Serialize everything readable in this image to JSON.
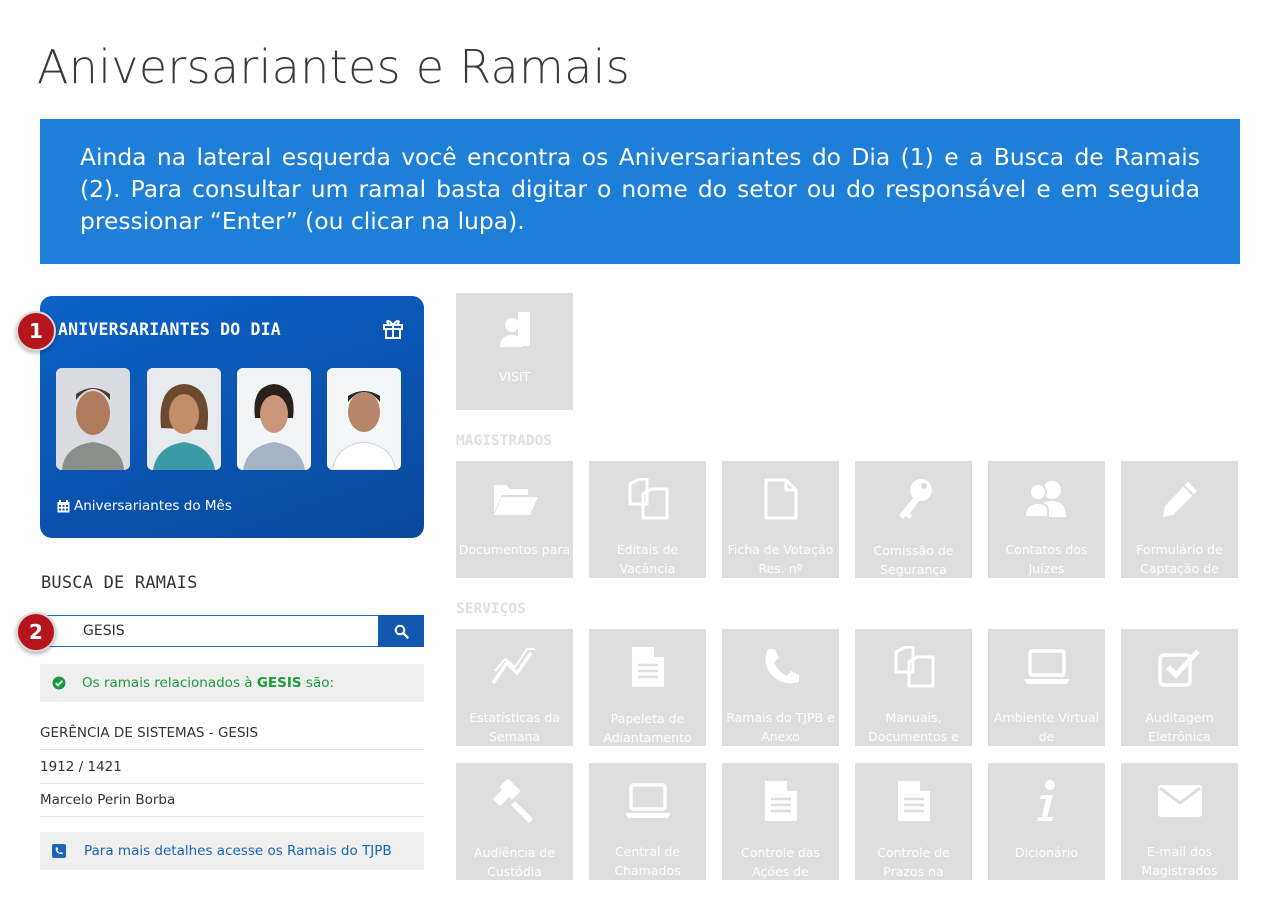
{
  "page": {
    "title": "Aniversariantes e Ramais"
  },
  "banner": {
    "text": "Ainda na lateral esquerda você encontra os Aniversariantes do Dia (1) e a Busca de Ramais (2). Para consultar um ramal basta digitar o nome do setor ou do responsável e em seguida pressionar “Enter” (ou clicar na lupa).",
    "color": "#1d7fd8"
  },
  "birthdays": {
    "title": "ANIVERSARIANTES DO DIA",
    "month_link": "Aniversariantes do Mês",
    "badge": "1",
    "photos": [
      {
        "name": "photo-1"
      },
      {
        "name": "photo-2"
      },
      {
        "name": "photo-3"
      },
      {
        "name": "photo-4"
      }
    ]
  },
  "ramais": {
    "heading": "BUSCA DE RAMAIS",
    "badge": "2",
    "search_value": "GESIS",
    "result_prefix": "Os ramais relacionados à ",
    "result_term": "GESIS",
    "result_suffix": " são:",
    "department": "GERÊNCIA DE SISTEMAS - GESIS",
    "extensions": "1912 / 1421",
    "responsible": "Marcelo Perin Borba",
    "more_details": "Para mais detalhes acesse os Ramais do TJPB"
  },
  "tiles": {
    "visit": {
      "label": "VISIT",
      "icon": "visit-icon"
    },
    "magistrados_label": "MAGISTRADOS",
    "servicos_label": "SERVIÇOS",
    "magistrados": [
      {
        "label": "Documentos para",
        "icon": "folder-open-icon"
      },
      {
        "label": "Editais de Vacância",
        "icon": "copy-icon"
      },
      {
        "label": "Ficha de Votação Res. nº",
        "icon": "file-icon"
      },
      {
        "label": "Comissão de Segurança",
        "icon": "key-icon"
      },
      {
        "label": "Contatos dos Juízes",
        "icon": "users-icon"
      },
      {
        "label": "Formulário de Captação de",
        "icon": "pencil-icon"
      }
    ],
    "servicos_row1": [
      {
        "label": "Estatísticas da Semana",
        "icon": "line-chart-icon"
      },
      {
        "label": "Papeleta de Adiantamento",
        "icon": "document-icon"
      },
      {
        "label": "Ramais do TJPB e Anexo",
        "icon": "phone-icon"
      },
      {
        "label": "Manuais, Documentos e",
        "icon": "copy-icon"
      },
      {
        "label": "Ambiente Virtual de",
        "icon": "laptop-icon"
      },
      {
        "label": "Auditagem Eletrônica",
        "icon": "checkbox-icon"
      }
    ],
    "servicos_row2": [
      {
        "label": "Audiência de Custódia",
        "icon": "gavel-icon"
      },
      {
        "label": "Central de Chamados",
        "icon": "laptop-icon"
      },
      {
        "label": "Controle das Ações de",
        "icon": "document-icon"
      },
      {
        "label": "Controle de Prazos na",
        "icon": "document-icon"
      },
      {
        "label": "Dicionário",
        "icon": "info-icon"
      },
      {
        "label": "E-mail dos Magistrados",
        "icon": "envelope-icon"
      }
    ]
  }
}
